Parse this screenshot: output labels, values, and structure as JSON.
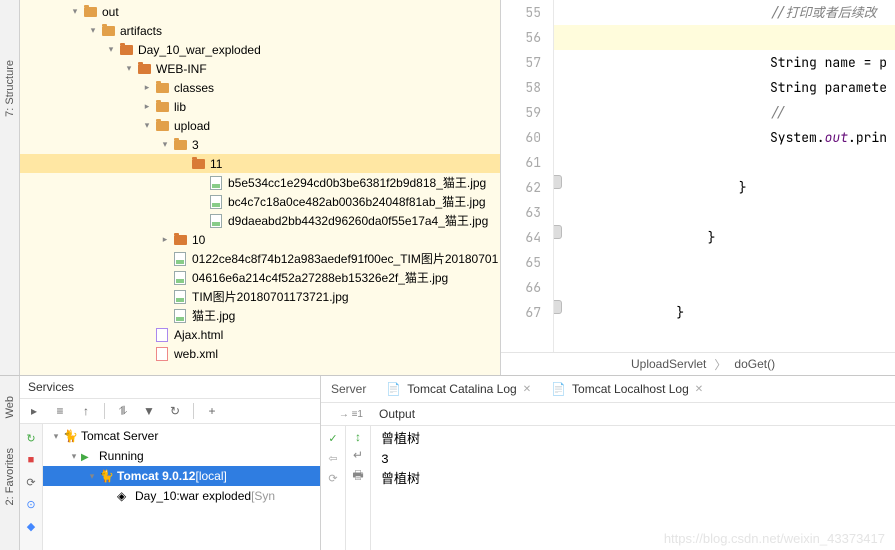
{
  "leftStrip": {
    "structure": "7: Structure",
    "web": "Web",
    "fav": "2: Favorites"
  },
  "tree": [
    {
      "indent": 48,
      "arrow": "down",
      "icon": "folder",
      "sel": false,
      "label": "out",
      "bold": false
    },
    {
      "indent": 66,
      "arrow": "down",
      "icon": "folder",
      "sel": false,
      "label": "artifacts",
      "bold": false
    },
    {
      "indent": 84,
      "arrow": "down",
      "icon": "folder",
      "sel": true,
      "label": "Day_10_war_exploded",
      "bold": false
    },
    {
      "indent": 102,
      "arrow": "down",
      "icon": "folder",
      "sel": true,
      "label": "WEB-INF",
      "bold": false
    },
    {
      "indent": 120,
      "arrow": "right",
      "icon": "folder",
      "sel": false,
      "label": "classes",
      "bold": false
    },
    {
      "indent": 120,
      "arrow": "right",
      "icon": "folder",
      "sel": false,
      "label": "lib",
      "bold": false
    },
    {
      "indent": 120,
      "arrow": "down",
      "icon": "folder",
      "sel": false,
      "label": "upload",
      "bold": false
    },
    {
      "indent": 138,
      "arrow": "down",
      "icon": "folder",
      "sel": false,
      "label": "3",
      "bold": false
    },
    {
      "indent": 156,
      "arrow": "none",
      "icon": "folder",
      "sel": true,
      "label": "11",
      "bold": false,
      "selected": true
    },
    {
      "indent": 174,
      "arrow": "none",
      "icon": "file-img",
      "label": "b5e534cc1e294cd0b3be6381f2b9d818_猫王.jpg"
    },
    {
      "indent": 174,
      "arrow": "none",
      "icon": "file-img",
      "label": "bc4c7c18a0ce482ab0036b24048f81ab_猫王.jpg"
    },
    {
      "indent": 174,
      "arrow": "none",
      "icon": "file-img",
      "label": "d9daeabd2bb4432d96260da0f55e17a4_猫王.jpg"
    },
    {
      "indent": 138,
      "arrow": "right",
      "icon": "folder",
      "sel": true,
      "label": "10",
      "bold": false
    },
    {
      "indent": 138,
      "arrow": "none",
      "icon": "file-img",
      "label": "0122ce84c8f74b12a983aedef91f00ec_TIM图片20180701"
    },
    {
      "indent": 138,
      "arrow": "none",
      "icon": "file-img",
      "label": "04616e6a214c4f52a27288eb15326e2f_猫王.jpg"
    },
    {
      "indent": 138,
      "arrow": "none",
      "icon": "file-img",
      "label": "TIM图片20180701173721.jpg"
    },
    {
      "indent": 138,
      "arrow": "none",
      "icon": "file-img",
      "label": "猫王.jpg"
    },
    {
      "indent": 120,
      "arrow": "none",
      "icon": "file-html",
      "label": "Ajax.html"
    },
    {
      "indent": 120,
      "arrow": "none",
      "icon": "file-xml",
      "label": "web.xml"
    }
  ],
  "code": {
    "startLine": 55,
    "lines": [
      {
        "n": 55,
        "html": "                    <span class='cm'>//打印或者后续改</span>"
      },
      {
        "n": 56,
        "html": "",
        "hl": true
      },
      {
        "n": 57,
        "html": "                    String name = p"
      },
      {
        "n": 58,
        "html": "                    String paramete"
      },
      {
        "n": 59,
        "html": "                    <span class='cm'>//</span>"
      },
      {
        "n": 60,
        "html": "                    System.<span class='fld'>out</span>.prin"
      },
      {
        "n": 61,
        "html": ""
      },
      {
        "n": 62,
        "html": "                }",
        "grip": true
      },
      {
        "n": 63,
        "html": ""
      },
      {
        "n": 64,
        "html": "            }",
        "grip": true
      },
      {
        "n": 65,
        "html": ""
      },
      {
        "n": 66,
        "html": ""
      },
      {
        "n": 67,
        "html": "        }",
        "grip": true
      }
    ]
  },
  "breadcrumb": {
    "a": "UploadServlet",
    "b": "doGet()"
  },
  "services": {
    "title": "Services",
    "toolbar": [
      "▸",
      "≡",
      "↑",
      "⥮",
      "▼",
      "↻",
      "+"
    ],
    "tree": [
      {
        "indent": 6,
        "arrow": "down",
        "icon": "tc",
        "label": "Tomcat Server"
      },
      {
        "indent": 24,
        "arrow": "down",
        "icon": "run",
        "label": "Running"
      },
      {
        "indent": 42,
        "arrow": "down",
        "icon": "tc",
        "label": "Tomcat 9.0.12",
        "suffix": "[local]",
        "selected": true
      },
      {
        "indent": 60,
        "arrow": "none",
        "icon": "art",
        "label": "Day_10:war exploded",
        "suffix": "[Syn",
        "grey": true
      }
    ]
  },
  "runTabs": {
    "server": "Server",
    "cat": "Tomcat Catalina Log",
    "loc": "Tomcat Localhost Log"
  },
  "output": {
    "label": "Output",
    "lines": [
      "曾植树",
      "3",
      "曾植树"
    ]
  },
  "watermark": "https://blog.csdn.net/weixin_43373417"
}
